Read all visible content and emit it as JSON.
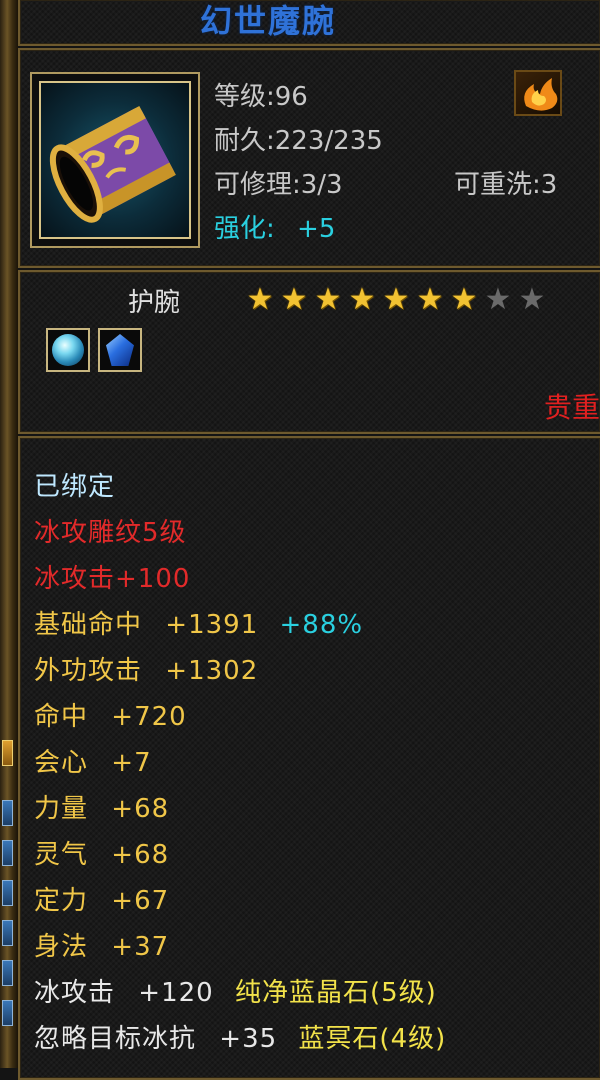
{
  "item": {
    "name": "幻世魔腕",
    "level": "等级:96",
    "durability": "耐久:223/235",
    "repairable": "可修理:3/3",
    "rewash": "可重洗:3",
    "enhance_label": "强化:",
    "enhance_value": "+5",
    "type": "护腕",
    "stars_filled": 7,
    "stars_total": 9,
    "precious_label": "贵重",
    "icon": "purple-gold-bracer-icon",
    "rune_icon": "fire-rune-icon",
    "gem_icons": [
      "ice-crystal-gem-icon",
      "blue-sapphire-gem-icon"
    ]
  },
  "attributes": {
    "bound": "已绑定",
    "engrave": "冰攻雕纹5级",
    "ice_attack": "冰攻击+100",
    "base_hit_label": "基础命中",
    "base_hit_value": "+1391",
    "base_hit_pct": "+88%",
    "outer_attack_label": "外功攻击",
    "outer_attack_value": "+1302",
    "hit_label": "命中",
    "hit_value": "+720",
    "crit_label": "会心",
    "crit_value": "+7",
    "str_label": "力量",
    "str_value": "+68",
    "spirit_label": "灵气",
    "spirit_value": "+68",
    "focus_label": "定力",
    "focus_value": "+67",
    "agility_label": "身法",
    "agility_value": "+37",
    "gem1_label": "冰攻击",
    "gem1_value": "+120",
    "gem1_name": "纯净蓝晶石(5级)",
    "gem2_label": "忽略目标冰抗",
    "gem2_value": "+35",
    "gem2_name": "蓝冥石(4级)"
  },
  "colors": {
    "title": "#2f72d8",
    "red_text": "#e22a2a",
    "gold_text": "#f0c648",
    "cyan_text": "#2ad0e0",
    "gem_name": "#f2e24a",
    "star_on": "#f2c232",
    "star_off": "#6a6a6a"
  }
}
